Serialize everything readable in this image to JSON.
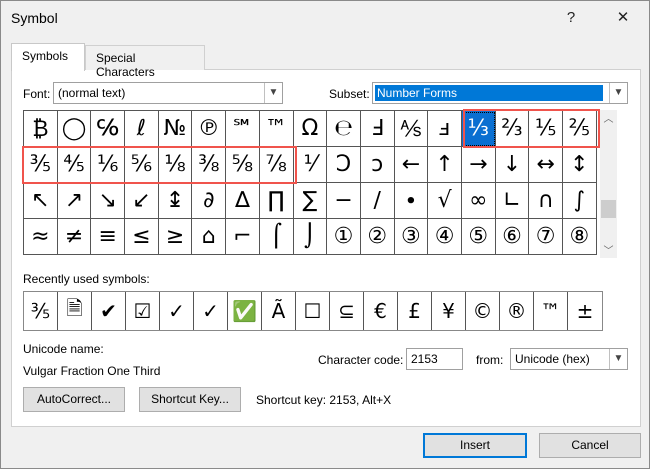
{
  "window": {
    "title": "Symbol",
    "help": "?",
    "close": "✕"
  },
  "tabs": [
    {
      "label": "Symbols"
    },
    {
      "label": "Special Characters"
    }
  ],
  "font": {
    "label": "Font:",
    "value": "(normal text)"
  },
  "subset": {
    "label": "Subset:",
    "value": "Number Forms"
  },
  "symbols": [
    [
      "₿",
      "◯",
      "℅",
      "ℓ",
      "№",
      "℗",
      "℠",
      "™",
      "Ω",
      "℮",
      "Ⅎ",
      "⅍",
      "ⅎ",
      "⅓",
      "⅔",
      "⅕",
      "⅖"
    ],
    [
      "⅗",
      "⅘",
      "⅙",
      "⅚",
      "⅛",
      "⅜",
      "⅝",
      "⅞",
      "⅟",
      "Ↄ",
      "ↄ",
      "←",
      "↑",
      "→",
      "↓",
      "↔",
      "↕"
    ],
    [
      "↖",
      "↗",
      "↘",
      "↙",
      "↨",
      "∂",
      "∆",
      "∏",
      "∑",
      "−",
      "∕",
      "∙",
      "√",
      "∞",
      "∟",
      "∩",
      "∫"
    ],
    [
      "≈",
      "≠",
      "≡",
      "≤",
      "≥",
      "⌂",
      "⌐",
      "⌠",
      "⌡",
      "①",
      "②",
      "③",
      "④",
      "⑤",
      "⑥",
      "⑦",
      "⑧"
    ]
  ],
  "selected_symbol": "⅓",
  "recent": {
    "label": "Recently used symbols:",
    "items": [
      "⅗",
      "🗎",
      "✔",
      "☑",
      "✓",
      "✓",
      "✅",
      "Ã",
      "☐",
      "⊆",
      "€",
      "£",
      "¥",
      "©",
      "®",
      "™",
      "±"
    ]
  },
  "unicode_name": {
    "label": "Unicode name:",
    "value": "Vulgar Fraction One Third"
  },
  "char_code": {
    "label": "Character code:",
    "value": "2153"
  },
  "from": {
    "label": "from:",
    "value": "Unicode (hex)"
  },
  "buttons": {
    "autocorrect": "AutoCorrect...",
    "shortcut": "Shortcut Key...",
    "insert": "Insert",
    "cancel": "Cancel"
  },
  "shortcut_text": "Shortcut key: 2153, Alt+X",
  "colors": {
    "highlight": "#f0544c",
    "selection": "#0a6fd1"
  }
}
